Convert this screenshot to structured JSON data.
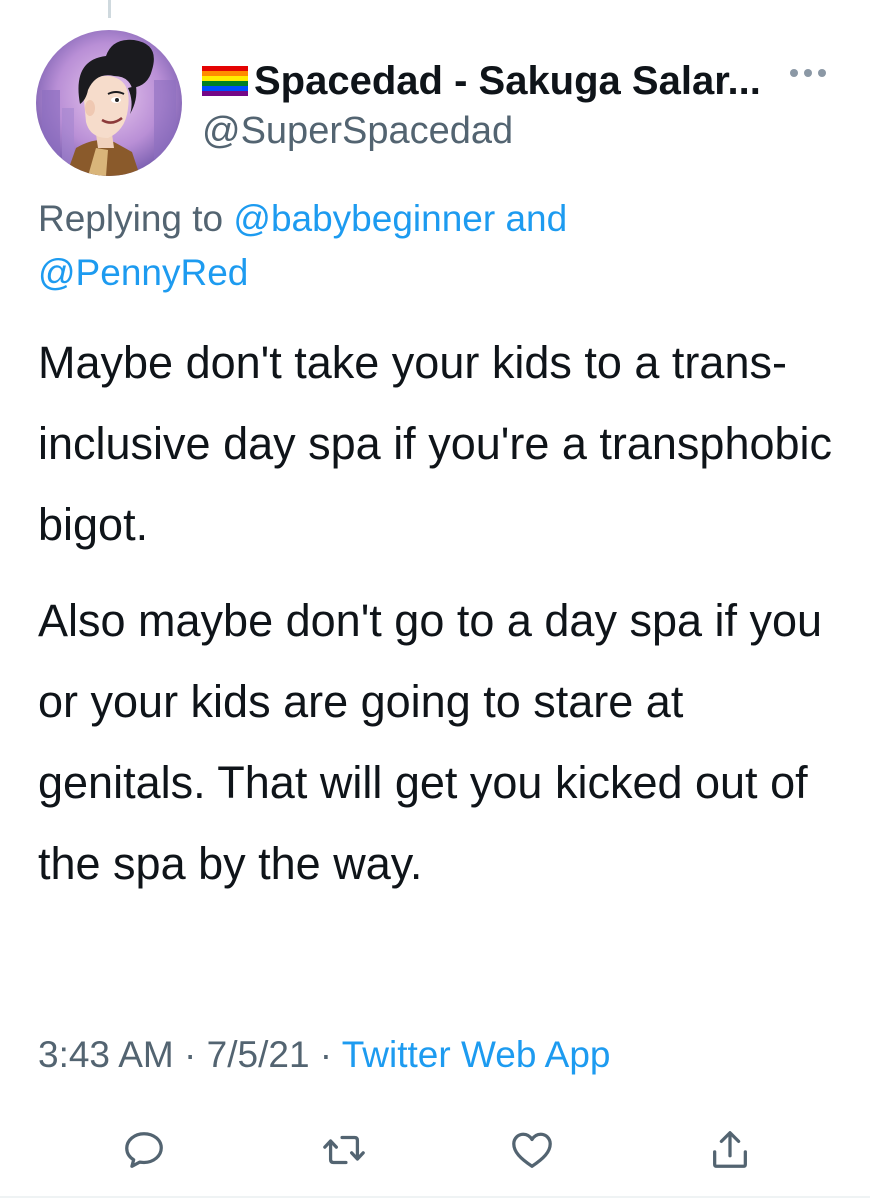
{
  "author": {
    "flag_icon": "pride-rainbow-flag-icon",
    "display_name": "Spacedad - Sakuga Salar...",
    "handle": "@SuperSpacedad",
    "avatar_icon": "cartoon-avatar"
  },
  "reply": {
    "prefix": "Replying to ",
    "mention_1": "@babybeginner",
    "conjunction": " and",
    "mention_2": "@PennyRed"
  },
  "tweet": {
    "paragraph_1": "Maybe don't take your kids to a trans-inclusive day spa if you're a transphobic bigot.",
    "paragraph_2": "Also maybe don't go to a day spa if you or your kids are going to stare at genitals.  That will get you kicked out of the spa by the way."
  },
  "meta": {
    "time": "3:43 AM",
    "separator": " · ",
    "date": "7/5/21",
    "source": "Twitter Web App"
  },
  "actions": {
    "reply_icon": "reply-icon",
    "retweet_icon": "retweet-icon",
    "like_icon": "heart-icon",
    "share_icon": "share-icon"
  },
  "colors": {
    "link": "#1d9bf0",
    "secondary_text": "#536471",
    "primary_text": "#0f1419"
  }
}
